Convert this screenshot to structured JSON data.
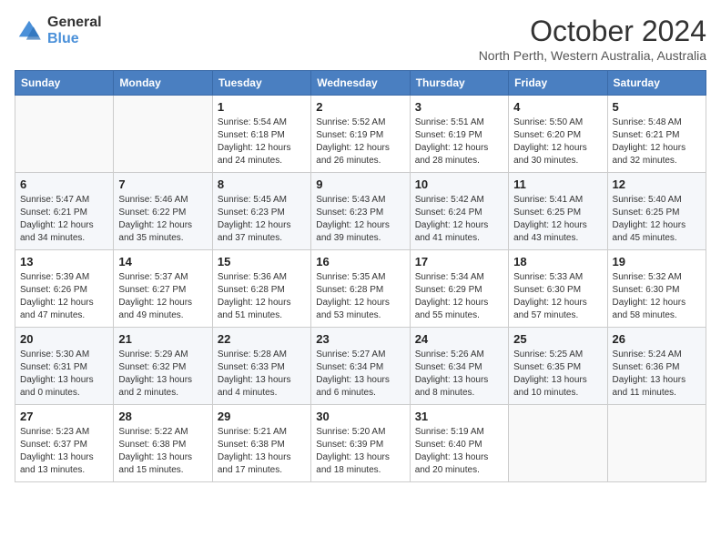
{
  "logo": {
    "line1": "General",
    "line2": "Blue"
  },
  "title": "October 2024",
  "subtitle": "North Perth, Western Australia, Australia",
  "days_of_week": [
    "Sunday",
    "Monday",
    "Tuesday",
    "Wednesday",
    "Thursday",
    "Friday",
    "Saturday"
  ],
  "weeks": [
    [
      {
        "day": "",
        "sunrise": "",
        "sunset": "",
        "daylight": ""
      },
      {
        "day": "",
        "sunrise": "",
        "sunset": "",
        "daylight": ""
      },
      {
        "day": "1",
        "sunrise": "Sunrise: 5:54 AM",
        "sunset": "Sunset: 6:18 PM",
        "daylight": "Daylight: 12 hours and 24 minutes."
      },
      {
        "day": "2",
        "sunrise": "Sunrise: 5:52 AM",
        "sunset": "Sunset: 6:19 PM",
        "daylight": "Daylight: 12 hours and 26 minutes."
      },
      {
        "day": "3",
        "sunrise": "Sunrise: 5:51 AM",
        "sunset": "Sunset: 6:19 PM",
        "daylight": "Daylight: 12 hours and 28 minutes."
      },
      {
        "day": "4",
        "sunrise": "Sunrise: 5:50 AM",
        "sunset": "Sunset: 6:20 PM",
        "daylight": "Daylight: 12 hours and 30 minutes."
      },
      {
        "day": "5",
        "sunrise": "Sunrise: 5:48 AM",
        "sunset": "Sunset: 6:21 PM",
        "daylight": "Daylight: 12 hours and 32 minutes."
      }
    ],
    [
      {
        "day": "6",
        "sunrise": "Sunrise: 5:47 AM",
        "sunset": "Sunset: 6:21 PM",
        "daylight": "Daylight: 12 hours and 34 minutes."
      },
      {
        "day": "7",
        "sunrise": "Sunrise: 5:46 AM",
        "sunset": "Sunset: 6:22 PM",
        "daylight": "Daylight: 12 hours and 35 minutes."
      },
      {
        "day": "8",
        "sunrise": "Sunrise: 5:45 AM",
        "sunset": "Sunset: 6:23 PM",
        "daylight": "Daylight: 12 hours and 37 minutes."
      },
      {
        "day": "9",
        "sunrise": "Sunrise: 5:43 AM",
        "sunset": "Sunset: 6:23 PM",
        "daylight": "Daylight: 12 hours and 39 minutes."
      },
      {
        "day": "10",
        "sunrise": "Sunrise: 5:42 AM",
        "sunset": "Sunset: 6:24 PM",
        "daylight": "Daylight: 12 hours and 41 minutes."
      },
      {
        "day": "11",
        "sunrise": "Sunrise: 5:41 AM",
        "sunset": "Sunset: 6:25 PM",
        "daylight": "Daylight: 12 hours and 43 minutes."
      },
      {
        "day": "12",
        "sunrise": "Sunrise: 5:40 AM",
        "sunset": "Sunset: 6:25 PM",
        "daylight": "Daylight: 12 hours and 45 minutes."
      }
    ],
    [
      {
        "day": "13",
        "sunrise": "Sunrise: 5:39 AM",
        "sunset": "Sunset: 6:26 PM",
        "daylight": "Daylight: 12 hours and 47 minutes."
      },
      {
        "day": "14",
        "sunrise": "Sunrise: 5:37 AM",
        "sunset": "Sunset: 6:27 PM",
        "daylight": "Daylight: 12 hours and 49 minutes."
      },
      {
        "day": "15",
        "sunrise": "Sunrise: 5:36 AM",
        "sunset": "Sunset: 6:28 PM",
        "daylight": "Daylight: 12 hours and 51 minutes."
      },
      {
        "day": "16",
        "sunrise": "Sunrise: 5:35 AM",
        "sunset": "Sunset: 6:28 PM",
        "daylight": "Daylight: 12 hours and 53 minutes."
      },
      {
        "day": "17",
        "sunrise": "Sunrise: 5:34 AM",
        "sunset": "Sunset: 6:29 PM",
        "daylight": "Daylight: 12 hours and 55 minutes."
      },
      {
        "day": "18",
        "sunrise": "Sunrise: 5:33 AM",
        "sunset": "Sunset: 6:30 PM",
        "daylight": "Daylight: 12 hours and 57 minutes."
      },
      {
        "day": "19",
        "sunrise": "Sunrise: 5:32 AM",
        "sunset": "Sunset: 6:30 PM",
        "daylight": "Daylight: 12 hours and 58 minutes."
      }
    ],
    [
      {
        "day": "20",
        "sunrise": "Sunrise: 5:30 AM",
        "sunset": "Sunset: 6:31 PM",
        "daylight": "Daylight: 13 hours and 0 minutes."
      },
      {
        "day": "21",
        "sunrise": "Sunrise: 5:29 AM",
        "sunset": "Sunset: 6:32 PM",
        "daylight": "Daylight: 13 hours and 2 minutes."
      },
      {
        "day": "22",
        "sunrise": "Sunrise: 5:28 AM",
        "sunset": "Sunset: 6:33 PM",
        "daylight": "Daylight: 13 hours and 4 minutes."
      },
      {
        "day": "23",
        "sunrise": "Sunrise: 5:27 AM",
        "sunset": "Sunset: 6:34 PM",
        "daylight": "Daylight: 13 hours and 6 minutes."
      },
      {
        "day": "24",
        "sunrise": "Sunrise: 5:26 AM",
        "sunset": "Sunset: 6:34 PM",
        "daylight": "Daylight: 13 hours and 8 minutes."
      },
      {
        "day": "25",
        "sunrise": "Sunrise: 5:25 AM",
        "sunset": "Sunset: 6:35 PM",
        "daylight": "Daylight: 13 hours and 10 minutes."
      },
      {
        "day": "26",
        "sunrise": "Sunrise: 5:24 AM",
        "sunset": "Sunset: 6:36 PM",
        "daylight": "Daylight: 13 hours and 11 minutes."
      }
    ],
    [
      {
        "day": "27",
        "sunrise": "Sunrise: 5:23 AM",
        "sunset": "Sunset: 6:37 PM",
        "daylight": "Daylight: 13 hours and 13 minutes."
      },
      {
        "day": "28",
        "sunrise": "Sunrise: 5:22 AM",
        "sunset": "Sunset: 6:38 PM",
        "daylight": "Daylight: 13 hours and 15 minutes."
      },
      {
        "day": "29",
        "sunrise": "Sunrise: 5:21 AM",
        "sunset": "Sunset: 6:38 PM",
        "daylight": "Daylight: 13 hours and 17 minutes."
      },
      {
        "day": "30",
        "sunrise": "Sunrise: 5:20 AM",
        "sunset": "Sunset: 6:39 PM",
        "daylight": "Daylight: 13 hours and 18 minutes."
      },
      {
        "day": "31",
        "sunrise": "Sunrise: 5:19 AM",
        "sunset": "Sunset: 6:40 PM",
        "daylight": "Daylight: 13 hours and 20 minutes."
      },
      {
        "day": "",
        "sunrise": "",
        "sunset": "",
        "daylight": ""
      },
      {
        "day": "",
        "sunrise": "",
        "sunset": "",
        "daylight": ""
      }
    ]
  ]
}
